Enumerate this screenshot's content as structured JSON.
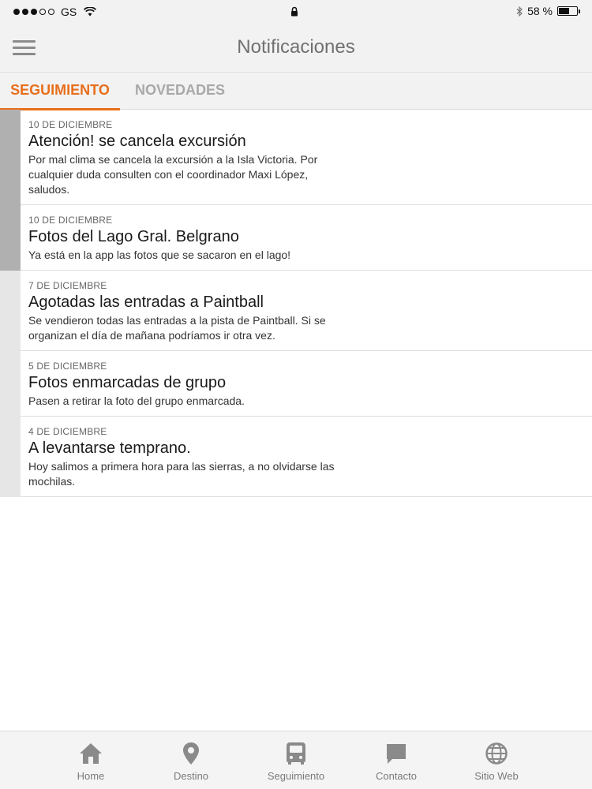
{
  "status_bar": {
    "carrier": "GS",
    "battery": "58 %",
    "battery_level": 0.58
  },
  "header": {
    "title": "Notificaciones"
  },
  "tabs": [
    {
      "label": "SEGUIMIENTO",
      "active": true
    },
    {
      "label": "NOVEDADES",
      "active": false
    }
  ],
  "notifications": [
    {
      "date": "10 DE DICIEMBRE",
      "title": "Atención! se cancela excursión",
      "body": "Por mal clima se cancela la excursión a la Isla Victoria. Por cualquier duda consulten con el coordinador Maxi López, saludos.",
      "unread": true
    },
    {
      "date": "10 DE DICIEMBRE",
      "title": "Fotos del Lago Gral. Belgrano",
      "body": "Ya está en la app las fotos que se sacaron en el lago!",
      "unread": true
    },
    {
      "date": "7 DE DICIEMBRE",
      "title": "Agotadas las entradas a Paintball",
      "body": "Se vendieron todas las entradas a la pista de Paintball. Si se organizan el día de mañana podríamos ir otra vez.",
      "unread": false
    },
    {
      "date": "5 DE DICIEMBRE",
      "title": "Fotos enmarcadas de grupo",
      "body": "Pasen a retirar la foto del grupo enmarcada.",
      "unread": false
    },
    {
      "date": "4 DE DICIEMBRE",
      "title": "A levantarse temprano.",
      "body": "Hoy salimos a primera hora para las sierras, a no olvidarse las mochilas.",
      "unread": false
    }
  ],
  "bottom_nav": [
    {
      "label": "Home",
      "icon": "home-icon"
    },
    {
      "label": "Destino",
      "icon": "location-pin-icon"
    },
    {
      "label": "Seguimiento",
      "icon": "bus-icon"
    },
    {
      "label": "Contacto",
      "icon": "chat-icon"
    },
    {
      "label": "Sitio Web",
      "icon": "globe-icon"
    }
  ],
  "colors": {
    "accent": "#e86e1c",
    "unread_bar": "#b0b0b0",
    "read_bar": "#e6e6e6"
  }
}
